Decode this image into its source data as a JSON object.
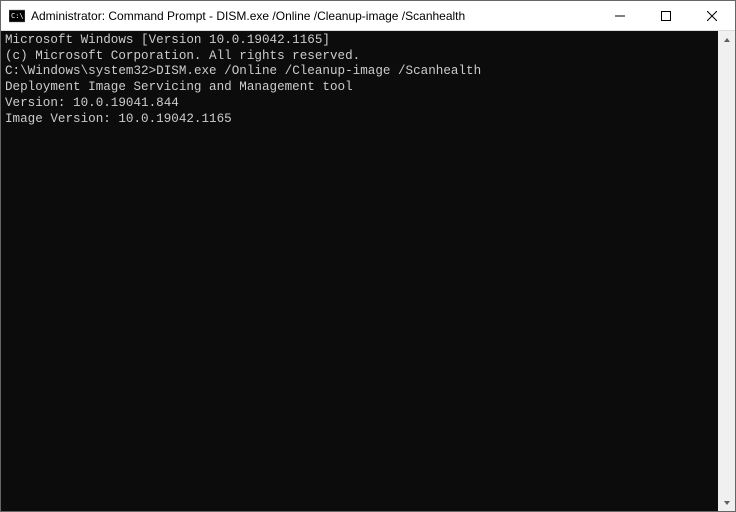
{
  "window": {
    "title": "Administrator: Command Prompt - DISM.exe  /Online /Cleanup-image /Scanhealth"
  },
  "terminal": {
    "line1": "Microsoft Windows [Version 10.0.19042.1165]",
    "line2": "(c) Microsoft Corporation. All rights reserved.",
    "blank1": "",
    "prompt_path": "C:\\Windows\\system32>",
    "command": "DISM.exe /Online /Cleanup-image /Scanhealth",
    "blank2": "",
    "tool_name": "Deployment Image Servicing and Management tool",
    "tool_version": "Version: 10.0.19041.844",
    "blank3": "",
    "image_version": "Image Version: 10.0.19042.1165"
  }
}
